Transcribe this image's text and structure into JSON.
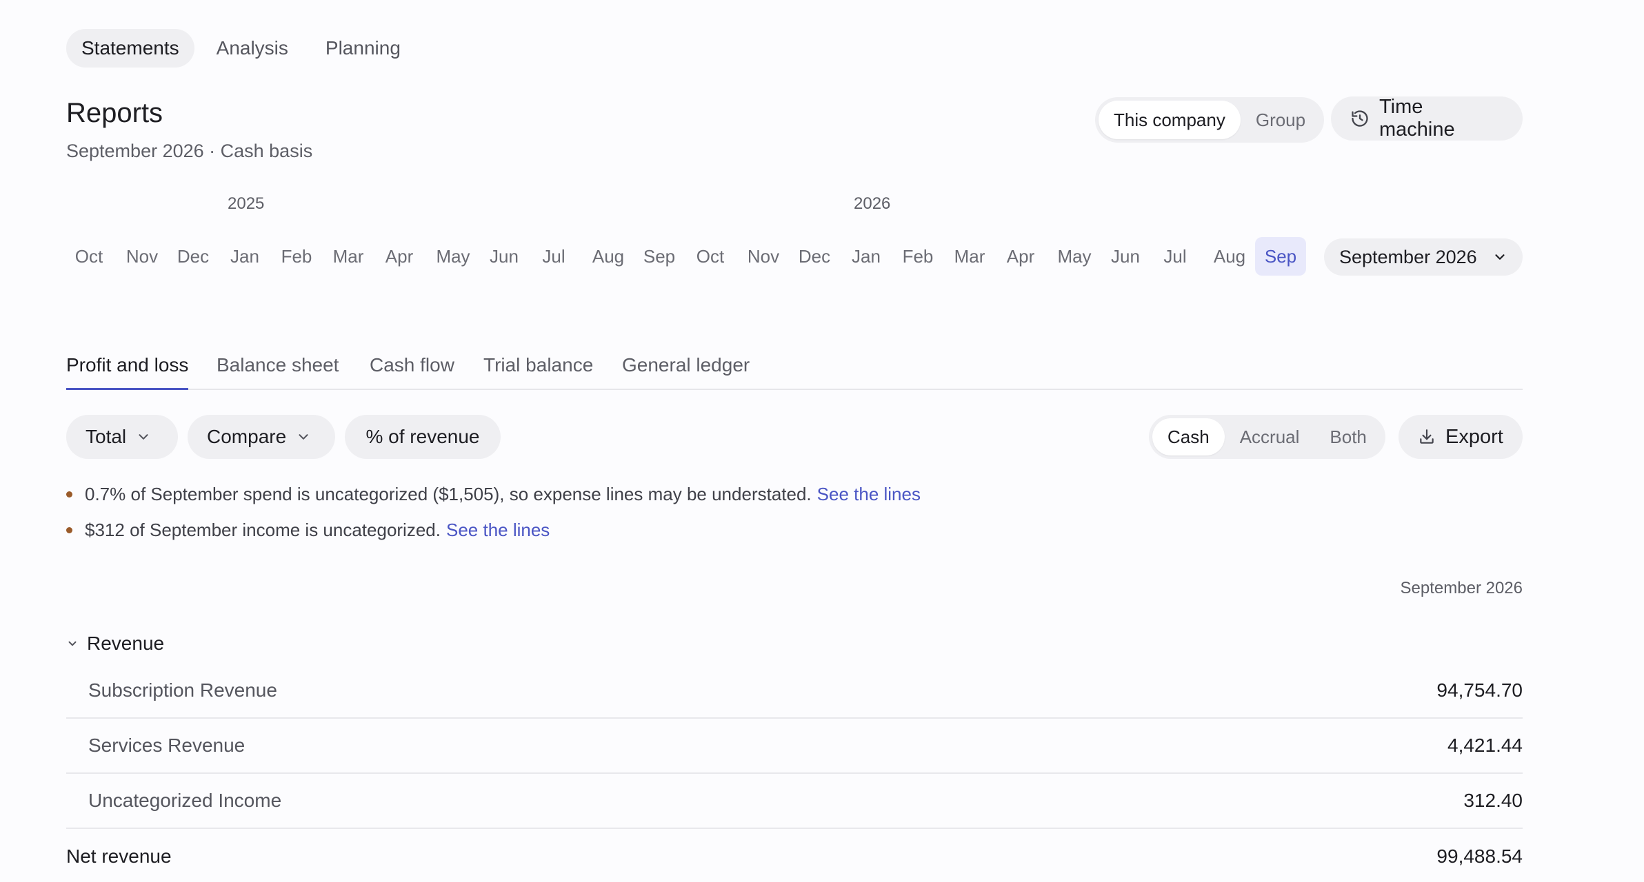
{
  "nav": {
    "tabs": [
      {
        "label": "Statements",
        "active": true
      },
      {
        "label": "Analysis",
        "active": false
      },
      {
        "label": "Planning",
        "active": false
      }
    ]
  },
  "header": {
    "title": "Reports",
    "subtitle": "September 2026 · Cash basis",
    "entity": [
      "This company",
      "Group"
    ],
    "time_machine_label": "Time machine"
  },
  "timeline": {
    "years": [
      "2025",
      "2026"
    ],
    "months": [
      "Oct",
      "Nov",
      "Dec",
      "Jan",
      "Feb",
      "Mar",
      "Apr",
      "May",
      "Jun",
      "Jul",
      "Aug",
      "Sep",
      "Oct",
      "Nov",
      "Dec",
      "Jan",
      "Feb",
      "Mar",
      "Apr",
      "May",
      "Jun",
      "Jul",
      "Aug",
      "Sep"
    ],
    "selected_index": 23,
    "period_select": "September 2026"
  },
  "report_tabs": [
    "Profit and loss",
    "Balance sheet",
    "Cash flow",
    "Trial balance",
    "General ledger"
  ],
  "filters": {
    "total": "Total",
    "compare": "Compare",
    "pct_revenue": "% of revenue",
    "basis": [
      "Cash",
      "Accrual",
      "Both"
    ],
    "export": "Export"
  },
  "warnings": [
    {
      "text": "0.7% of September spend is uncategorized ($1,505), so expense lines may be understated.",
      "link": "See the lines"
    },
    {
      "text": "$312 of September income is uncategorized.",
      "link": "See the lines"
    }
  ],
  "table": {
    "column_header": "September 2026",
    "section": "Revenue",
    "rows": [
      {
        "label": "Subscription Revenue",
        "value": "94,754.70"
      },
      {
        "label": "Services Revenue",
        "value": "4,421.44"
      },
      {
        "label": "Uncategorized Income",
        "value": "312.40"
      }
    ],
    "total": {
      "label": "Net revenue",
      "value": "99,488.54"
    }
  },
  "colors": {
    "accent": "#4a55c4",
    "warning_dot": "#9a5b2a",
    "selected_month_bg": "#e8e9fb"
  }
}
